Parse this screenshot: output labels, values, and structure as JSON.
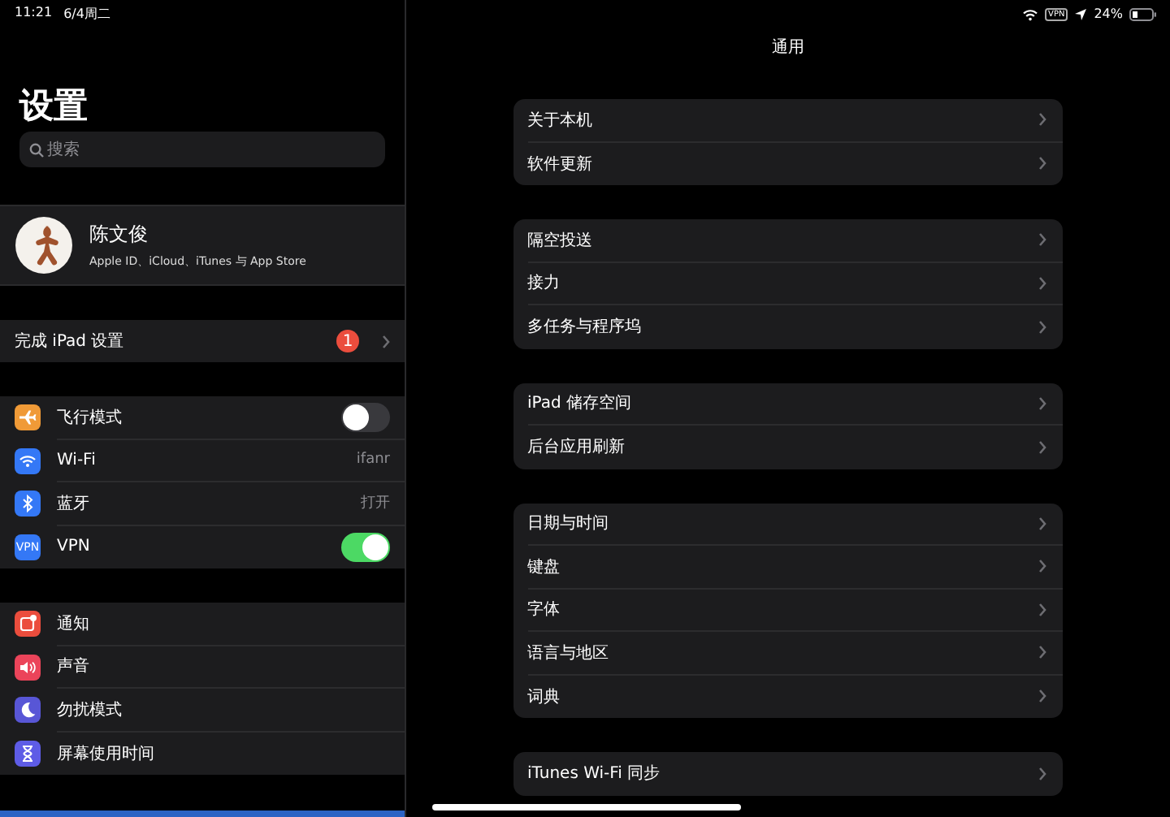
{
  "status_bar": {
    "time": "11:21",
    "date": "6/4周二",
    "vpn": "VPN",
    "battery": "24%"
  },
  "sidebar": {
    "title": "设置",
    "search": {
      "placeholder": "搜索"
    },
    "profile": {
      "name": "陈文俊",
      "subtitle": "Apple ID、iCloud、iTunes 与 App Store"
    },
    "setup": {
      "label": "完成 iPad 设置",
      "badge": "1"
    },
    "groups": [
      [
        {
          "kind": "toggle",
          "label": "飞行模式",
          "color": "#f09a37",
          "on": false
        },
        {
          "kind": "value",
          "label": "Wi-Fi",
          "color": "#3478f6",
          "value": "ifanr"
        },
        {
          "kind": "value",
          "label": "蓝牙",
          "color": "#3478f6",
          "value": "打开"
        },
        {
          "kind": "toggle",
          "label": "VPN",
          "color": "#3478f6",
          "icon_text": "VPN",
          "on": true
        }
      ],
      [
        {
          "kind": "plain",
          "label": "通知",
          "color": "#eb4d3d"
        },
        {
          "kind": "plain",
          "label": "声音",
          "color": "#eb445a"
        },
        {
          "kind": "plain",
          "label": "勿扰模式",
          "color": "#5856d6"
        },
        {
          "kind": "plain",
          "label": "屏幕使用时间",
          "color": "#5e5ce6"
        }
      ]
    ]
  },
  "detail": {
    "title": "通用",
    "groups": [
      [
        "关于本机",
        "软件更新"
      ],
      [
        "隔空投送",
        "接力",
        "多任务与程序坞"
      ],
      [
        "iPad 储存空间",
        "后台应用刷新"
      ],
      [
        "日期与时间",
        "键盘",
        "字体",
        "语言与地区",
        "词典"
      ],
      [
        "iTunes Wi-Fi 同步"
      ]
    ]
  }
}
